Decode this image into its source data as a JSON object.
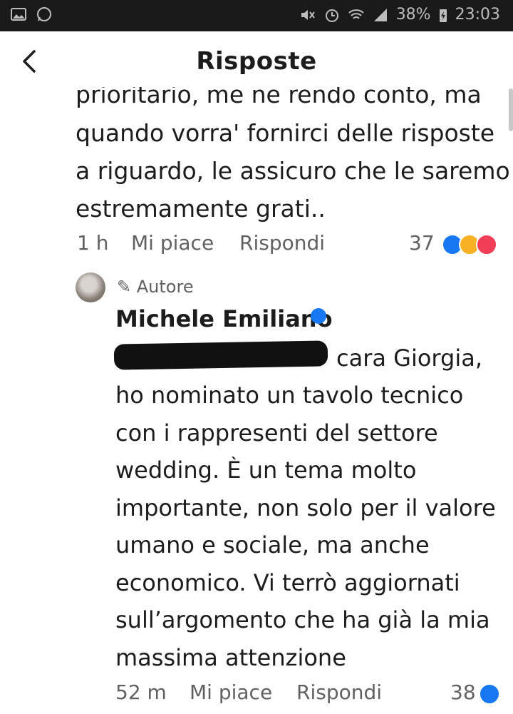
{
  "status_bar": {
    "battery": "38%",
    "time": "23:03"
  },
  "header": {
    "title": "Risposte"
  },
  "comment1": {
    "lines": [
      "prioritario, me ne rendo conto, ma",
      "quando vorra' fornirci delle risposte",
      "a riguardo, le assicuro che le saremo",
      "estremamente grati.."
    ],
    "time": "1 h",
    "like_label": "Mi piace",
    "reply_label": "Rispondi",
    "reaction_count": "37"
  },
  "reply": {
    "author_badge": "Autore",
    "author_name": "Michele Emiliano",
    "lines": [
      "cara Giorgia,",
      "ho nominato un tavolo tecnico",
      "con i rappresenti del settore",
      "wedding. È un tema molto",
      "importante, non solo per il valore",
      "umano e sociale, ma anche",
      "economico. Vi terrò aggiornati",
      "sull’argomento che ha già la mia",
      "massima attenzione"
    ],
    "time": "52 m",
    "like_label": "Mi piace",
    "reply_label": "Rispondi",
    "reaction_count": "38"
  },
  "colors": {
    "accent": "#1877f2",
    "love": "#f33e58",
    "care": "#f7b125"
  }
}
